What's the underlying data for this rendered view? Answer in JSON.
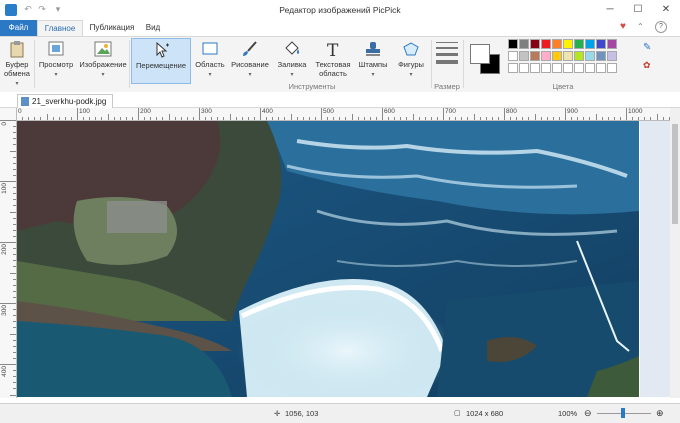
{
  "window": {
    "title": "Редактор изображений PicPick",
    "controls": [
      "─",
      "☐",
      "✕"
    ],
    "quick_access": [
      "↶",
      "↷",
      "▾"
    ],
    "heart": "♥",
    "help": "?"
  },
  "tabs": {
    "file": "Файл",
    "home": "Главное",
    "publish": "Публикация",
    "view": "Вид"
  },
  "ribbon": {
    "clipboard": "Буфер обмена",
    "view_btn": "Просмотр",
    "image_btn": "Изображение",
    "move_btn": "Перемещение",
    "area_btn": "Область",
    "draw_btn": "Рисование",
    "fill_btn": "Заливка",
    "text_btn": "Текстовая область",
    "stamp_btn": "Штампы",
    "shapes_btn": "Фигуры",
    "tools_label": "Инструменты",
    "size_label": "Размер",
    "colors_label": "Цвета"
  },
  "colors": {
    "primary": "#ffffff",
    "secondary": "#000000",
    "palette_row1": [
      "#000000",
      "#7f7f7f",
      "#880015",
      "#ed1c24",
      "#ff7f27",
      "#fff200",
      "#22b14c",
      "#00a2e8",
      "#3f48cc",
      "#a349a4"
    ],
    "palette_row2": [
      "#ffffff",
      "#c3c3c3",
      "#b97a57",
      "#ffaec9",
      "#ffc90e",
      "#efe4b0",
      "#b5e61d",
      "#99d9ea",
      "#7092be",
      "#c8bfe7"
    ],
    "palette_row3": [
      "#ffffff",
      "#ffffff",
      "#ffffff",
      "#ffffff",
      "#ffffff",
      "#ffffff",
      "#ffffff",
      "#ffffff",
      "#ffffff",
      "#ffffff"
    ],
    "accent": "#2b78c5"
  },
  "document": {
    "tab_name": "21_sverkhu-podk.jpg"
  },
  "ruler": {
    "top": [
      "0",
      "100",
      "200",
      "300",
      "400",
      "500",
      "600",
      "700",
      "800",
      "900",
      "1000"
    ],
    "left": [
      "0",
      "100",
      "200",
      "300",
      "400"
    ]
  },
  "status": {
    "cursor": "1056, 103",
    "size": "1024 x 680",
    "zoom": "100%",
    "zoom_minus": "⊖",
    "zoom_plus": "⊕"
  }
}
